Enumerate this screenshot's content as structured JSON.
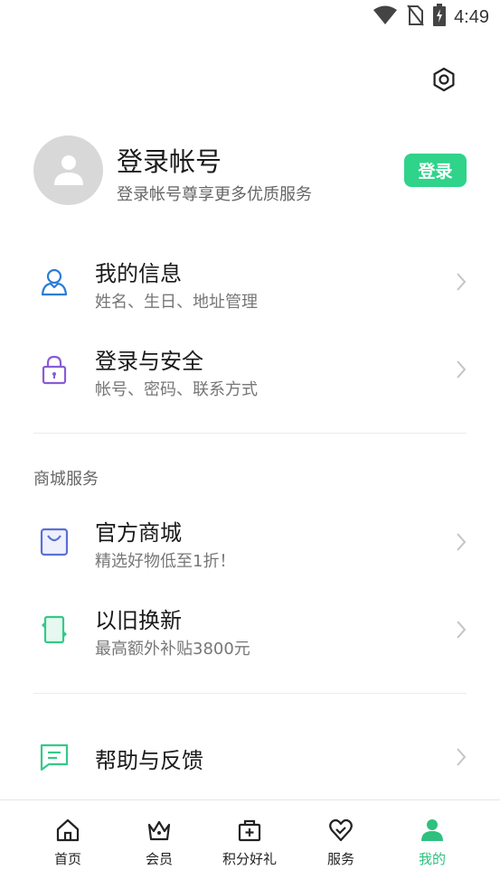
{
  "status_bar": {
    "time": "4:49",
    "icons": [
      "wifi-icon",
      "no-sim-icon",
      "battery-charging-icon"
    ]
  },
  "header": {
    "settings_icon": "gear-icon"
  },
  "profile": {
    "avatar_icon": "person-icon",
    "title": "登录帐号",
    "subtitle": "登录帐号尊享更多优质服务",
    "login_button": "登录"
  },
  "account_menu": [
    {
      "icon": "user-icon",
      "title": "我的信息",
      "subtitle": "姓名、生日、地址管理"
    },
    {
      "icon": "lock-icon",
      "title": "登录与安全",
      "subtitle": "帐号、密码、联系方式"
    }
  ],
  "mall_section": {
    "title": "商城服务",
    "items": [
      {
        "icon": "shopping-bag-icon",
        "title": "官方商城",
        "subtitle": "精选好物低至1折！"
      },
      {
        "icon": "phone-trade-in-icon",
        "title": "以旧换新",
        "subtitle": "最高额外补贴3800元"
      }
    ]
  },
  "help_item": {
    "icon": "chat-icon",
    "title": "帮助与反馈"
  },
  "bottom_nav": [
    {
      "icon": "home-icon",
      "label": "首页",
      "active": false
    },
    {
      "icon": "crown-icon",
      "label": "会员",
      "active": false
    },
    {
      "icon": "gift-icon",
      "label": "积分好礼",
      "active": false
    },
    {
      "icon": "heart-icon",
      "label": "服务",
      "active": false
    },
    {
      "icon": "person-icon",
      "label": "我的",
      "active": true
    }
  ],
  "colors": {
    "accent": "#2fd38a",
    "active_nav": "#2fc07f",
    "user_icon": "#2b7bd6",
    "lock_icon": "#8a5bd6",
    "bag_icon": "#5b6fd6",
    "trade_icon": "#34c98a",
    "chat_icon": "#34c98a"
  }
}
